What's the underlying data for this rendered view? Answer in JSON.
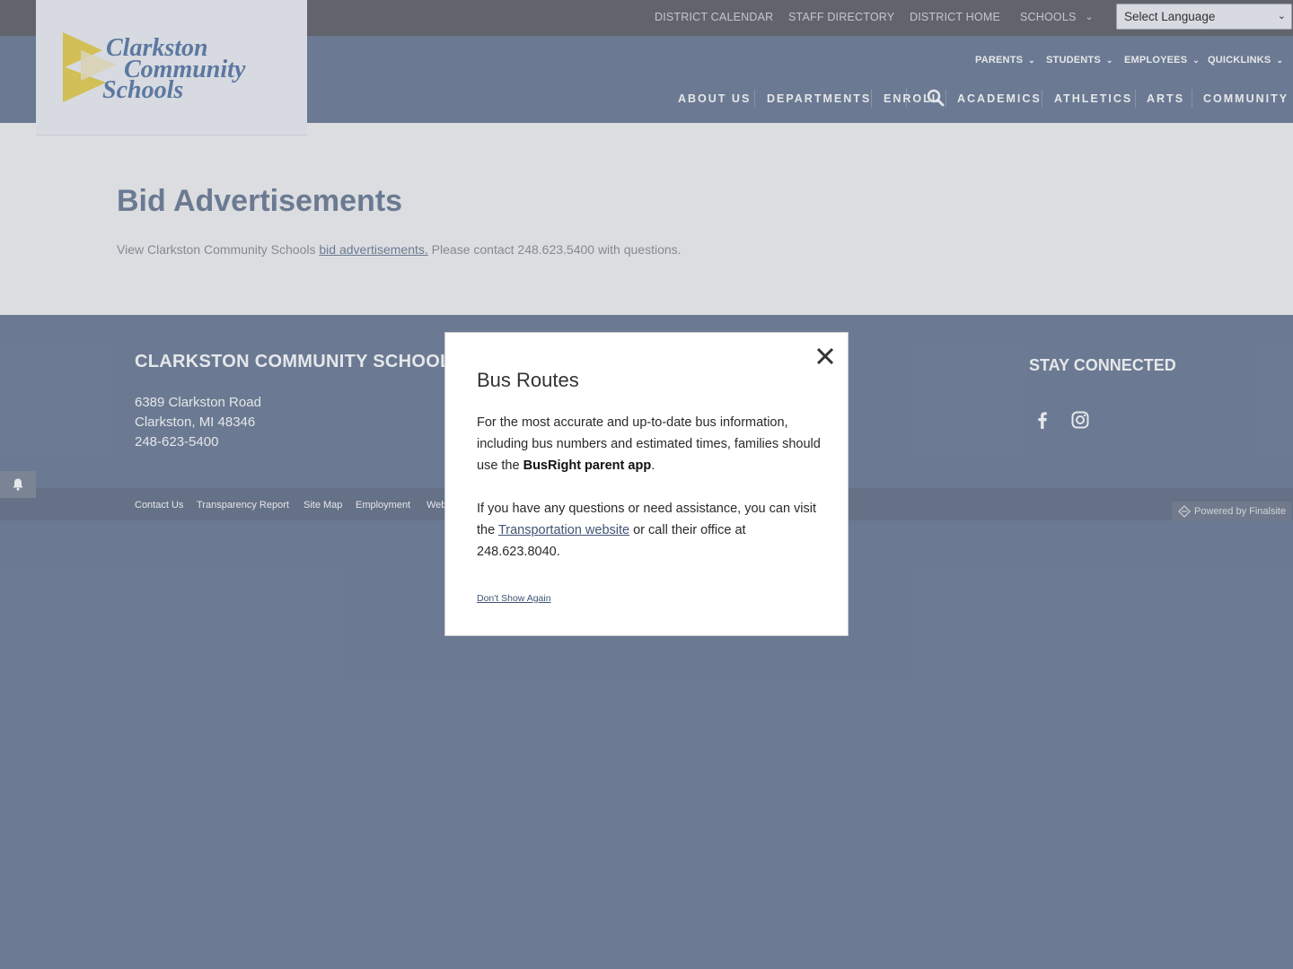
{
  "top_utility": {
    "links": [
      "DISTRICT CALENDAR",
      "STAFF DIRECTORY",
      "DISTRICT HOME",
      "SCHOOLS"
    ],
    "language_select": "Select Language"
  },
  "logo": {
    "line1": "Clarkston",
    "line2": "Community",
    "line3": "Schools"
  },
  "secondary_nav": [
    "PARENTS",
    "STUDENTS",
    "EMPLOYEES",
    "QUICKLINKS"
  ],
  "main_nav": [
    "ABOUT US",
    "DEPARTMENTS",
    "ENROLL",
    "ACADEMICS",
    "ATHLETICS",
    "ARTS",
    "COMMUNITY"
  ],
  "page": {
    "title": "Bid Advertisements",
    "text_before": "View Clarkston Community Schools ",
    "link": "bid advertisements.",
    "text_after": " Please contact 248.623.5400 with questions."
  },
  "footer": {
    "name": "CLARKSTON COMMUNITY SCHOOLS",
    "address1": "6389 Clarkston Road",
    "address2": "Clarkston, MI   48346",
    "phone": "248-623-5400",
    "stay_connected": "STAY CONNECTED",
    "links": [
      "Contact Us",
      "Transparency Report",
      "Site Map",
      "Employment",
      "Web"
    ],
    "powered": "Powered by Finalsite"
  },
  "modal": {
    "title": "Bus Routes",
    "p1_text": "For the most accurate and up-to-date bus information, including bus numbers and estimated times, families should use the ",
    "p1_bold": "BusRight parent app",
    "p1_end": ".",
    "p2_text": "If you have any questions or need assistance, you can visit the ",
    "p2_link": "Transportation website",
    "p2_end": " or call their office at 248.623.8040.",
    "dont_show": "Don't Show Again"
  },
  "colors": {
    "header_bg": "#6b7a94",
    "topbar_bg": "#5e6064",
    "title_color": "#6b7a94",
    "logo_yellow": "#e8cf4a",
    "logo_blue": "#5878a6"
  }
}
